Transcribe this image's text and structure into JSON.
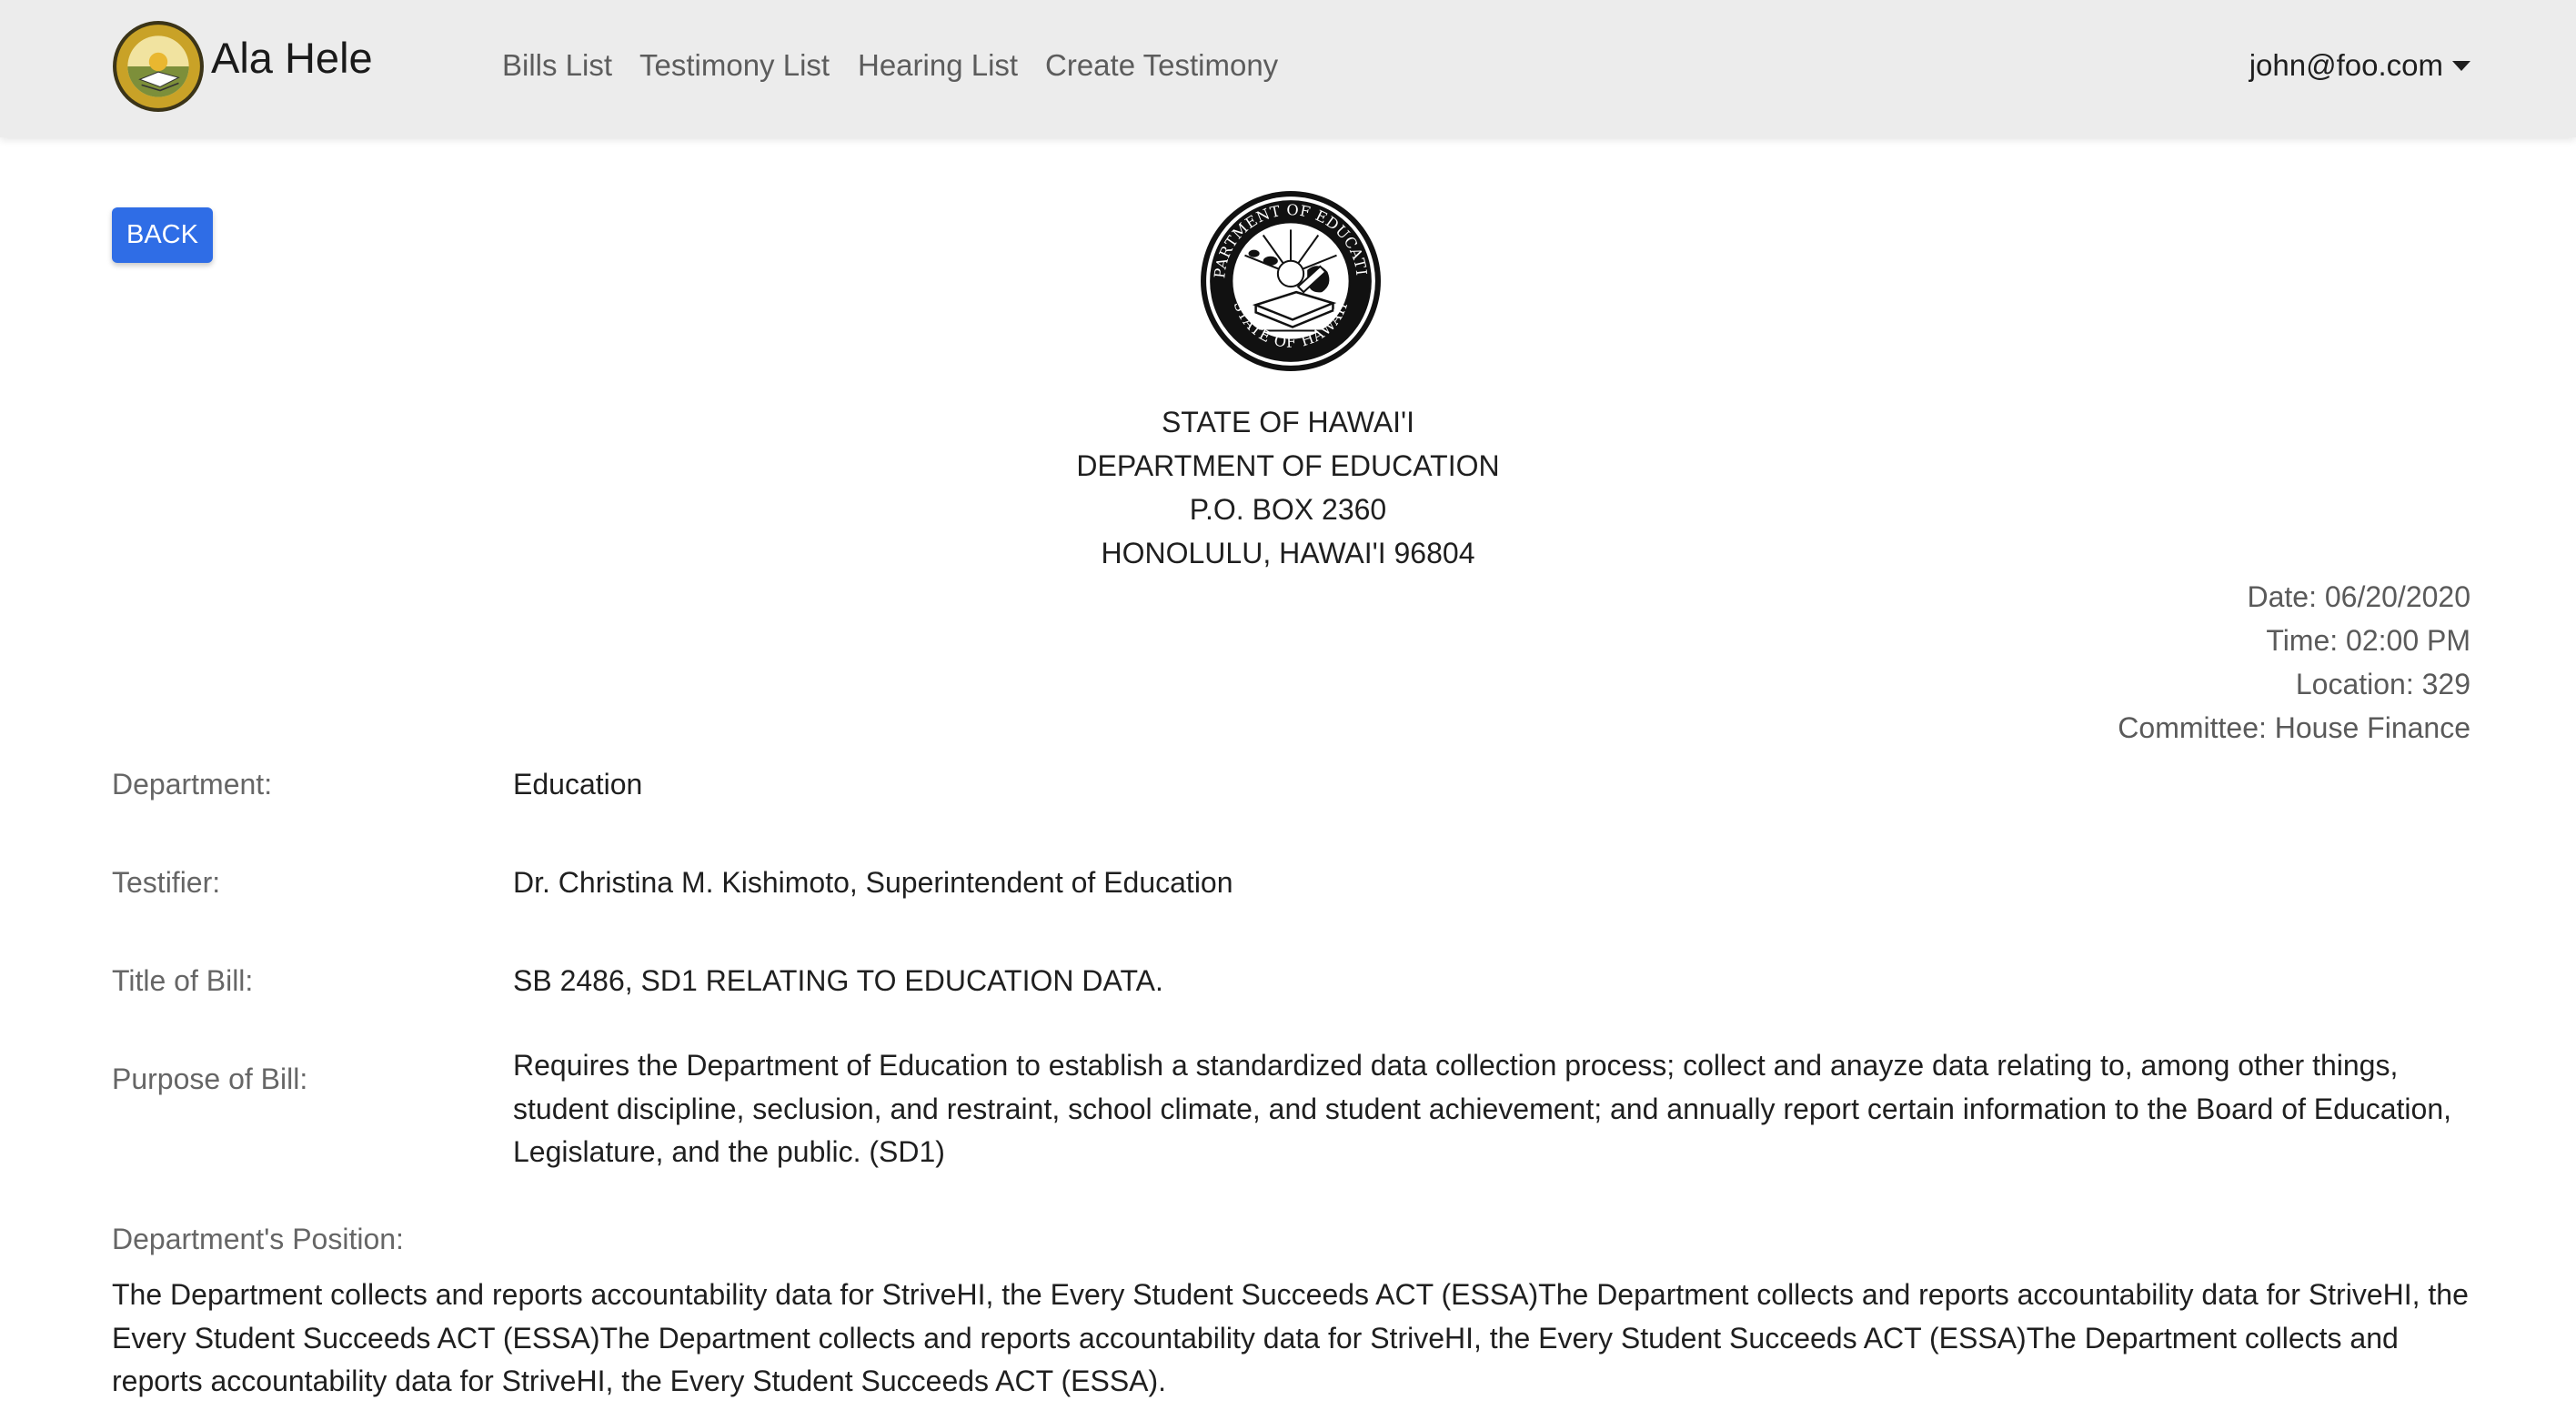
{
  "navbar": {
    "brand": "Ala Hele",
    "logo_icon": "hawaii-doe-seal-icon",
    "links": [
      "Bills List",
      "Testimony List",
      "Hearing List",
      "Create Testimony"
    ],
    "user": "john@foo.com"
  },
  "back_button": "BACK",
  "seal_icon": "hawaii-doe-seal-icon",
  "address": {
    "line1": "STATE OF HAWAI'I",
    "line2": "DEPARTMENT OF EDUCATION",
    "line3": "P.O. BOX 2360",
    "line4": "HONOLULU, HAWAI'I 96804"
  },
  "hearing": {
    "date": "Date: 06/20/2020",
    "time": "Time: 02:00 PM",
    "location": "Location: 329",
    "committee": "Committee: House Finance"
  },
  "fields": {
    "department": {
      "label": "Department:",
      "value": "Education"
    },
    "testifier": {
      "label": "Testifier:",
      "value": "Dr. Christina M. Kishimoto, Superintendent of Education"
    },
    "title": {
      "label": "Title of Bill:",
      "value": "SB 2486, SD1 RELATING TO EDUCATION DATA."
    },
    "purpose": {
      "label": "Purpose of Bill:",
      "value": "Requires the Department of Education to establish a standardized data collection process; collect and anayze data relating to, among other things, student discipline, seclusion, and restraint, school climate, and student achievement; and annually report certain information to the Board of Education, Legislature, and the public. (SD1)"
    },
    "position": {
      "label": "Department's Position:",
      "value": "The Department collects and reports accountability data for StriveHI, the Every Student Succeeds ACT (ESSA)The Department collects and reports accountability data for StriveHI, the Every Student Succeeds ACT (ESSA)The Department collects and reports accountability data for StriveHI, the Every Student Succeeds ACT (ESSA)The Department collects and reports accountability data for StriveHI, the Every Student Succeeds ACT (ESSA)."
    }
  }
}
